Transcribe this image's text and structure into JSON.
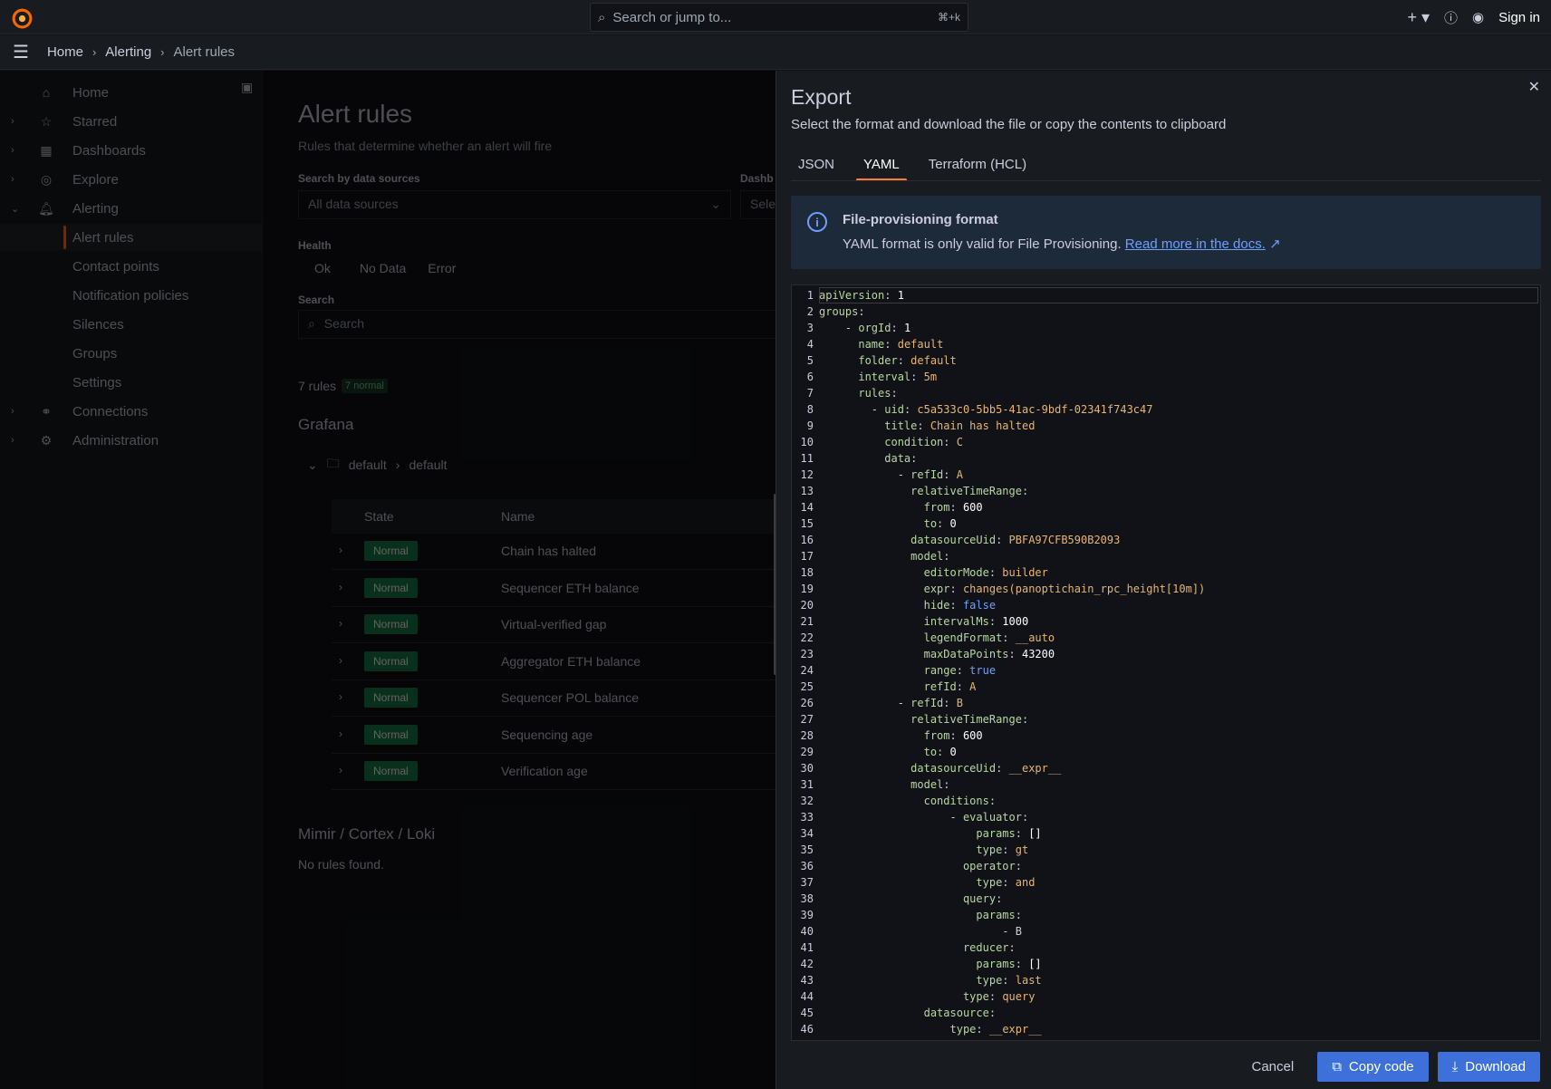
{
  "topbar": {
    "search_placeholder": "Search or jump to...",
    "shortcut": "⌘+k",
    "sign_in": "Sign in"
  },
  "breadcrumb": [
    "Home",
    "Alerting",
    "Alert rules"
  ],
  "sidebar": {
    "items": [
      {
        "label": "Home",
        "icon": "home-icon"
      },
      {
        "label": "Starred",
        "icon": "star-icon"
      },
      {
        "label": "Dashboards",
        "icon": "apps-icon"
      },
      {
        "label": "Explore",
        "icon": "compass-icon"
      },
      {
        "label": "Alerting",
        "icon": "bell-icon"
      },
      {
        "label": "Alert rules",
        "icon": ""
      },
      {
        "label": "Contact points",
        "icon": ""
      },
      {
        "label": "Notification policies",
        "icon": ""
      },
      {
        "label": "Silences",
        "icon": ""
      },
      {
        "label": "Groups",
        "icon": ""
      },
      {
        "label": "Settings",
        "icon": ""
      },
      {
        "label": "Connections",
        "icon": "link-icon"
      },
      {
        "label": "Administration",
        "icon": "cog-icon"
      }
    ]
  },
  "main": {
    "title": "Alert rules",
    "subtitle": "Rules that determine whether an alert will fire",
    "search_ds_label": "Search by data sources",
    "dashboard_label": "Dashb",
    "ds_placeholder": "All data sources",
    "dash_placeholder": "Sele",
    "health_label": "Health",
    "health_options": [
      "Ok",
      "No Data",
      "Error"
    ],
    "search_label": "Search",
    "search_placeholder": "Search",
    "rules_count": "7 rules",
    "normal_count": "7 normal",
    "section_grafana": "Grafana",
    "folder": "default",
    "group": "default",
    "col_state": "State",
    "col_name": "Name",
    "rules": [
      {
        "state": "Normal",
        "name": "Chain has halted"
      },
      {
        "state": "Normal",
        "name": "Sequencer ETH balance"
      },
      {
        "state": "Normal",
        "name": "Virtual-verified gap"
      },
      {
        "state": "Normal",
        "name": "Aggregator ETH balance"
      },
      {
        "state": "Normal",
        "name": "Sequencer POL balance"
      },
      {
        "state": "Normal",
        "name": "Sequencing age"
      },
      {
        "state": "Normal",
        "name": "Verification age"
      }
    ],
    "section_mimir": "Mimir / Cortex / Loki",
    "no_rules": "No rules found."
  },
  "drawer": {
    "title": "Export",
    "subtitle": "Select the format and download the file or copy the contents to clipboard",
    "tabs": [
      "JSON",
      "YAML",
      "Terraform (HCL)"
    ],
    "active_tab": "YAML",
    "info_title": "File-provisioning format",
    "info_text": "YAML format is only valid for File Provisioning.",
    "info_link": "Read more in the docs.",
    "cancel": "Cancel",
    "copy": "Copy code",
    "download": "Download"
  },
  "code_lines": [
    "apiVersion: 1",
    "groups:",
    "    - orgId: 1",
    "      name: default",
    "      folder: default",
    "      interval: 5m",
    "      rules:",
    "        - uid: c5a533c0-5bb5-41ac-9bdf-02341f743c47",
    "          title: Chain has halted",
    "          condition: C",
    "          data:",
    "            - refId: A",
    "              relativeTimeRange:",
    "                from: 600",
    "                to: 0",
    "              datasourceUid: PBFA97CFB590B2093",
    "              model:",
    "                editorMode: builder",
    "                expr: changes(panoptichain_rpc_height[10m])",
    "                hide: false",
    "                intervalMs: 1000",
    "                legendFormat: __auto",
    "                maxDataPoints: 43200",
    "                range: true",
    "                refId: A",
    "            - refId: B",
    "              relativeTimeRange:",
    "                from: 600",
    "                to: 0",
    "              datasourceUid: __expr__",
    "              model:",
    "                conditions:",
    "                    - evaluator:",
    "                        params: []",
    "                        type: gt",
    "                      operator:",
    "                        type: and",
    "                      query:",
    "                        params:",
    "                            - B",
    "                      reducer:",
    "                        params: []",
    "                        type: last",
    "                      type: query",
    "                datasource:",
    "                    type: __expr__"
  ],
  "colors": {
    "accent": "#ff7b3a",
    "primary": "#3d71d9",
    "normal_badge": "#1a7f4b"
  }
}
